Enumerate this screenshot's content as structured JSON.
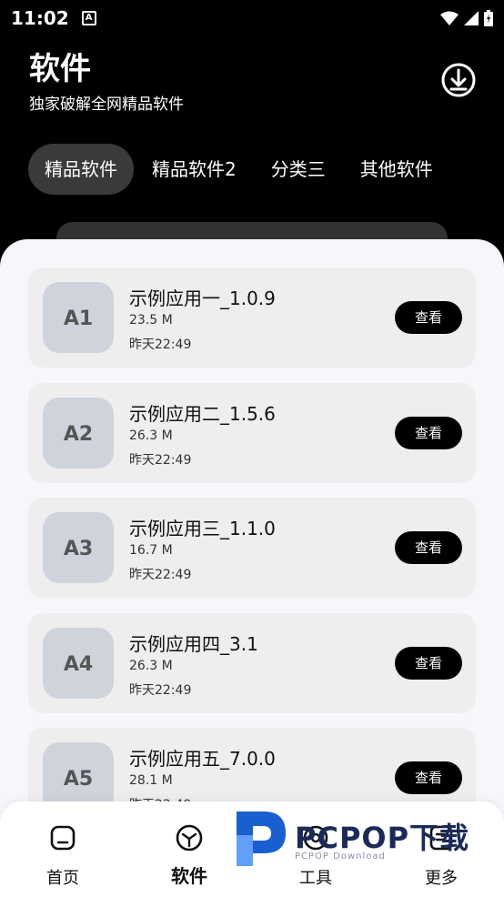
{
  "status_bar": {
    "time": "11:02",
    "notification_glyph": "A"
  },
  "header": {
    "title": "软件",
    "subtitle": "独家破解全网精品软件"
  },
  "tabs": [
    {
      "label": "精品软件",
      "active": true
    },
    {
      "label": "精品软件2",
      "active": false
    },
    {
      "label": "分类三",
      "active": false
    },
    {
      "label": "其他软件",
      "active": false
    }
  ],
  "apps": [
    {
      "name": "示例应用一_1.0.9",
      "size": "23.5 M",
      "date": "昨天22:49",
      "button": "查看",
      "icon_label": "A1",
      "icon_badge": ""
    },
    {
      "name": "示例应用二_1.5.6",
      "size": "26.3 M",
      "date": "昨天22:49",
      "button": "查看",
      "icon_label": "A2",
      "icon_badge": ""
    },
    {
      "name": "示例应用三_1.1.0",
      "size": "16.7 M",
      "date": "昨天22:49",
      "button": "查看",
      "icon_label": "A3",
      "icon_badge": ""
    },
    {
      "name": "示例应用四_3.1",
      "size": "26.3 M",
      "date": "昨天22:49",
      "button": "查看",
      "icon_label": "A4",
      "icon_badge": ""
    },
    {
      "name": "示例应用五_7.0.0",
      "size": "28.1 M",
      "date": "昨天22:49",
      "button": "查看",
      "icon_label": "A5",
      "icon_badge": ""
    }
  ],
  "bottom_nav": [
    {
      "label": "首页",
      "icon": "home-icon",
      "active": false
    },
    {
      "label": "软件",
      "icon": "cube-icon",
      "active": true
    },
    {
      "label": "工具",
      "icon": "tool-icon",
      "active": false
    },
    {
      "label": "更多",
      "icon": "more-icon",
      "active": false
    }
  ],
  "watermark": {
    "text": "PCPOP下载",
    "sub": "PCPOP Download"
  }
}
